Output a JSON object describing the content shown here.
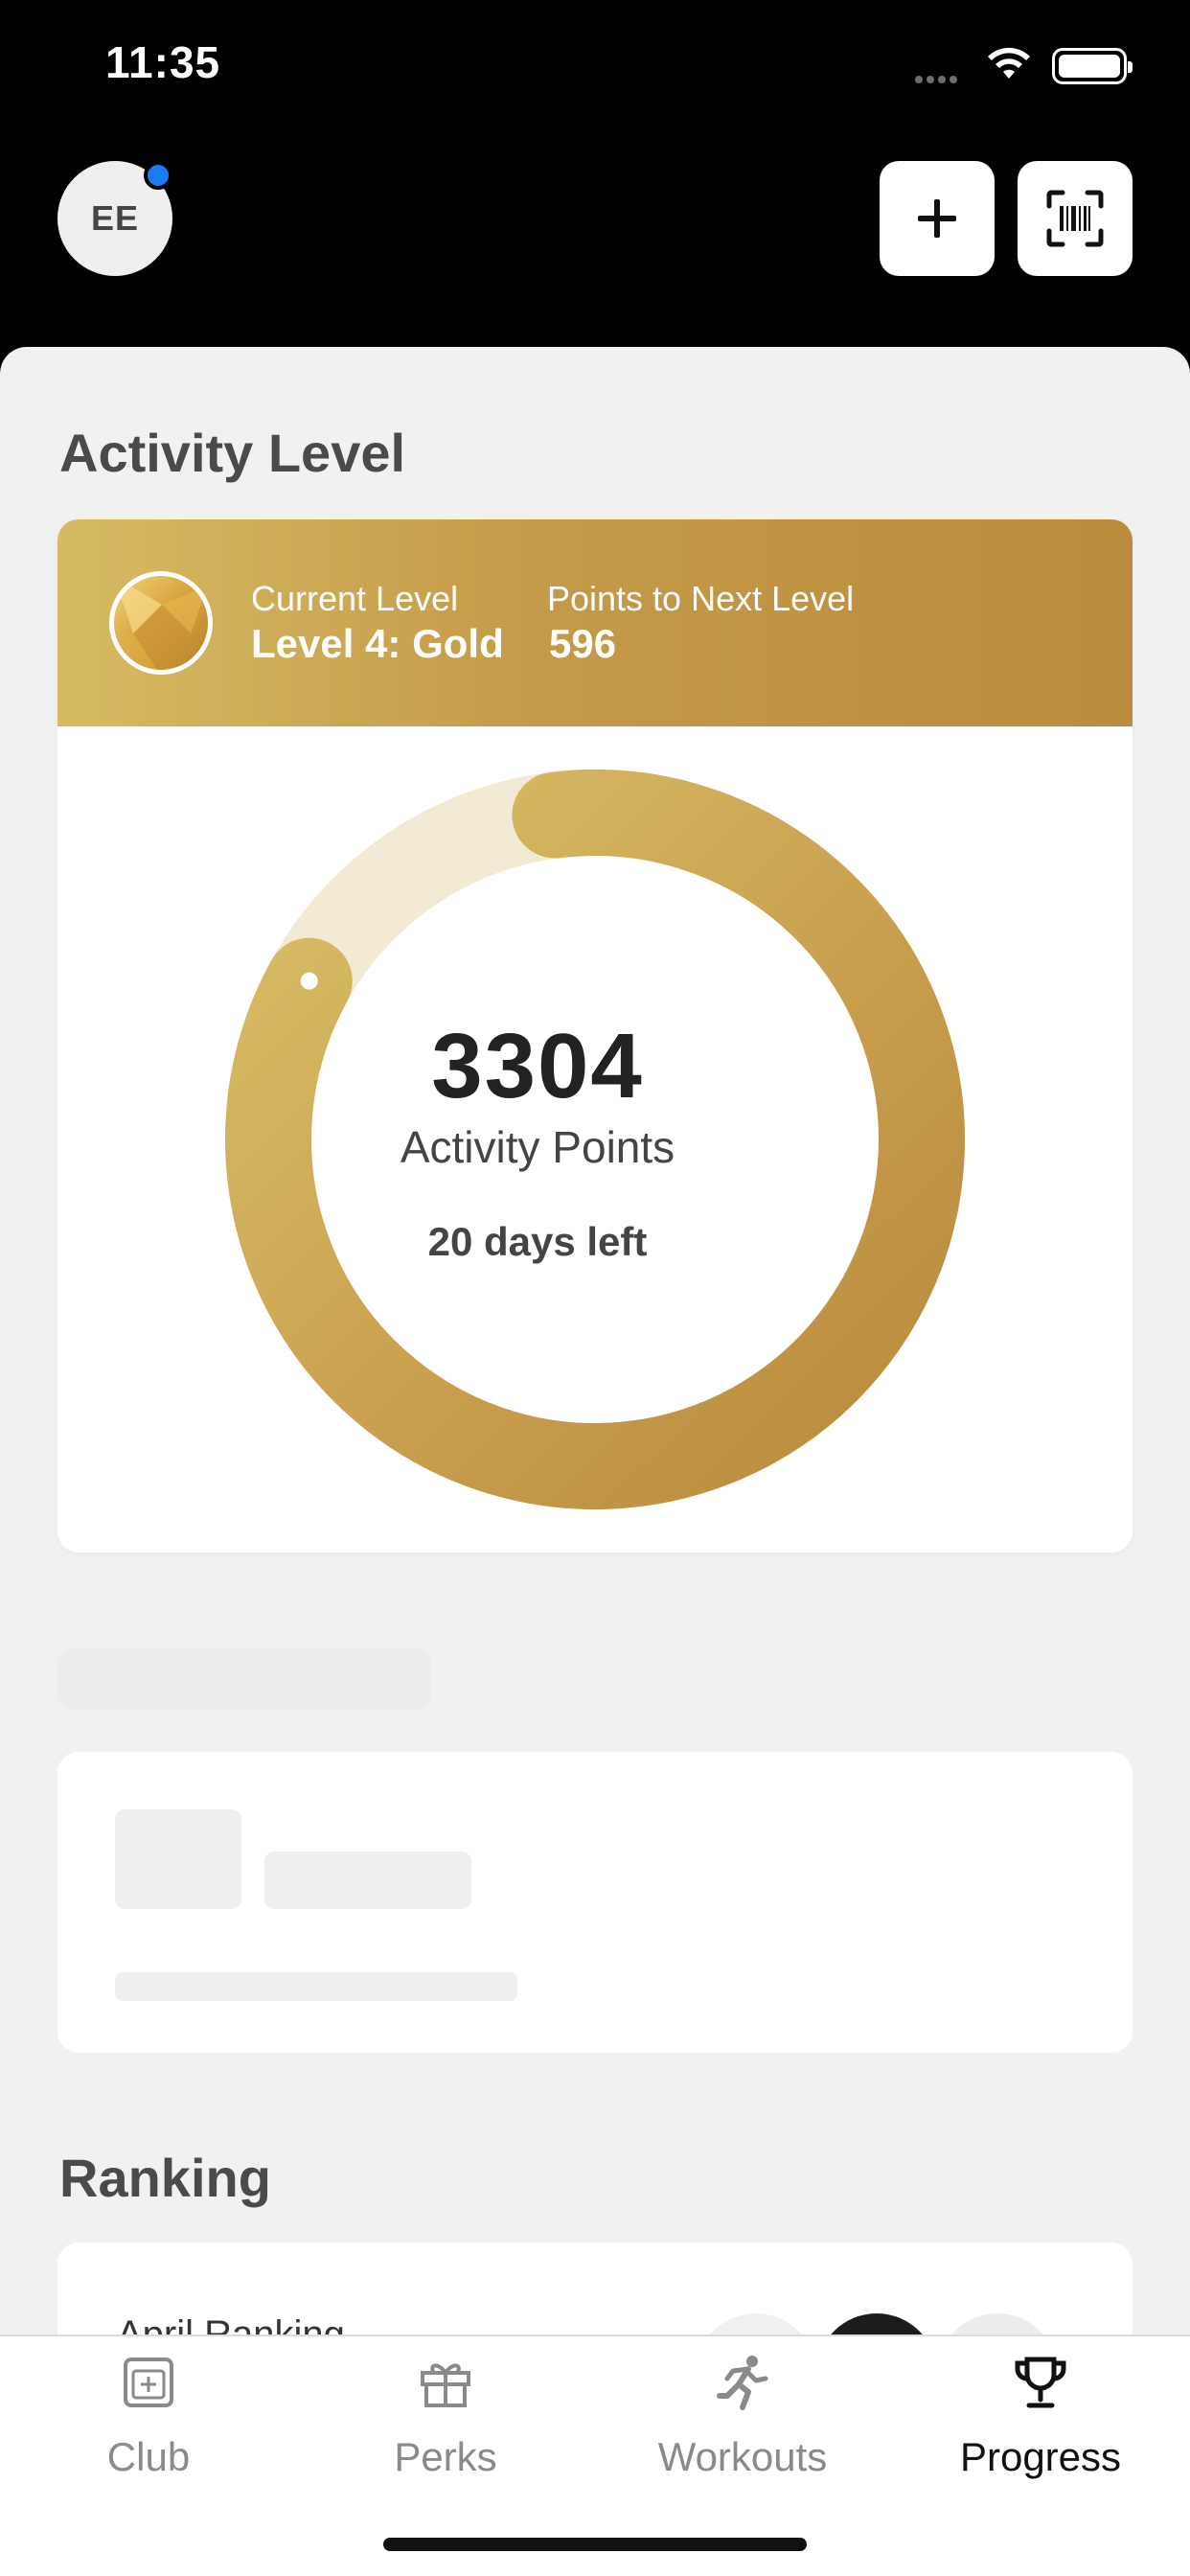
{
  "status_bar": {
    "time": "11:35"
  },
  "header": {
    "avatar_initials": "EE",
    "add_icon": "plus-icon",
    "scan_icon": "barcode-scan-icon",
    "notification_color": "#1a7cf5"
  },
  "activity": {
    "section_title": "Activity Level",
    "current_level_label": "Current Level",
    "current_level_value": "Level 4: Gold",
    "next_level_label": "Points to Next Level",
    "next_level_value": "596",
    "points": "3304",
    "points_label": "Activity Points",
    "days_left": "20 days left",
    "progress_fraction": 0.85,
    "accent_colors": [
      "#d6bb63",
      "#bb8c3d"
    ]
  },
  "ranking": {
    "section_title": "Ranking",
    "card_label": "April Ranking"
  },
  "tabbar": {
    "tabs": [
      {
        "label": "Club",
        "icon": "club-icon"
      },
      {
        "label": "Perks",
        "icon": "gift-icon"
      },
      {
        "label": "Workouts",
        "icon": "running-icon"
      },
      {
        "label": "Progress",
        "icon": "trophy-icon"
      }
    ],
    "active": "Progress"
  }
}
